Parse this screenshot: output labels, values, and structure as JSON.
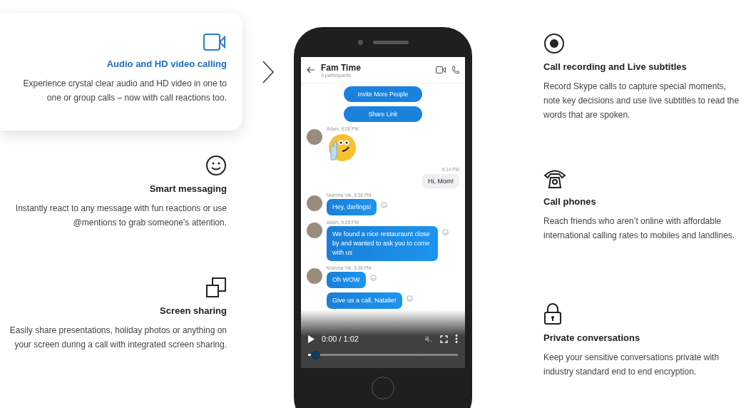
{
  "left_features": [
    {
      "title": "Audio and HD video calling",
      "description": "Experience crystal clear audio and HD video in one to one or group calls – now with call reactions too.",
      "selected": true
    },
    {
      "title": "Smart messaging",
      "description": "Instantly react to any message with fun reactions or use @mentions to grab someone’s attention.",
      "selected": false
    },
    {
      "title": "Screen sharing",
      "description": "Easily share presentations, holiday photos or anything on your screen during a call with integrated screen sharing.",
      "selected": false
    }
  ],
  "right_features": [
    {
      "title": "Call recording and Live subtitles",
      "description": "Record Skype calls to capture special moments, note key decisions and use live subtitles to read the words that are spoken."
    },
    {
      "title": "Call phones",
      "description": "Reach friends who aren’t online with affordable international calling rates to mobiles and landlines."
    },
    {
      "title": "Private conversations",
      "description": "Keep your sensitive conversations private with industry standard end to end encryption."
    }
  ],
  "phone": {
    "chat_title": "Fam Time",
    "chat_subtitle": "3 participants",
    "messages": [
      {
        "kind": "action",
        "text": "Invite More People"
      },
      {
        "kind": "action",
        "text": "Share Link"
      },
      {
        "kind": "sticker",
        "meta": "Adam, 6:26 PM"
      },
      {
        "kind": "outgoing",
        "meta": "6:14 PM",
        "text": "Hi, Mom!"
      },
      {
        "kind": "incoming",
        "meta": "Momma Vie, 6:38 PM",
        "text": "Hey, darlings!"
      },
      {
        "kind": "incoming",
        "meta": "Adam, 6:26 PM",
        "text": "We found a nice restauraunt close by and wanted to ask you to come with us"
      },
      {
        "kind": "incoming",
        "meta": "Momma Vie, 6:38 PM",
        "text": "Oh WOW"
      },
      {
        "kind": "incoming",
        "text": "Give us a call, Natalie!"
      }
    ],
    "video": {
      "time": "0:00 / 1:02",
      "level": 0.02
    }
  }
}
